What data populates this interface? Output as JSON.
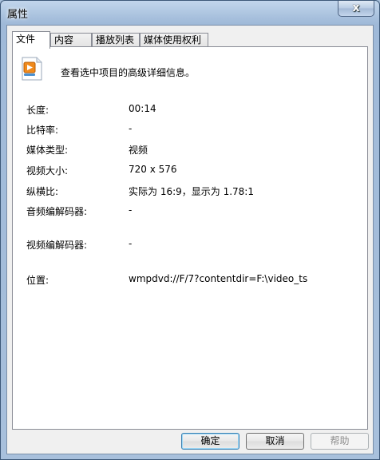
{
  "window": {
    "title": "属性",
    "close_symbol": "x"
  },
  "tabs": [
    {
      "label": "文件",
      "active": true
    },
    {
      "label": "内容",
      "active": false
    },
    {
      "label": "播放列表",
      "active": false
    },
    {
      "label": "媒体使用权利",
      "active": false
    }
  ],
  "header": {
    "description": "查看选中项目的高级详细信息。",
    "icon": "media-file-icon"
  },
  "properties": [
    {
      "label": "长度:",
      "value": "00:14"
    },
    {
      "label": "比特率:",
      "value": "-"
    },
    {
      "label": "媒体类型:",
      "value": "视频"
    },
    {
      "label": "视频大小:",
      "value": "720 x 576"
    },
    {
      "label": "纵横比:",
      "value": "实际为 16:9，显示为 1.78:1"
    },
    {
      "label": "音频编解码器:",
      "value": "-"
    },
    {
      "label": "视频编解码器:",
      "value": "-"
    },
    {
      "label": "位置:",
      "value": "wmpdvd://F/7?contentdir=F:\\video_ts"
    }
  ],
  "buttons": {
    "ok": "确定",
    "cancel": "取消",
    "help": "帮助"
  }
}
